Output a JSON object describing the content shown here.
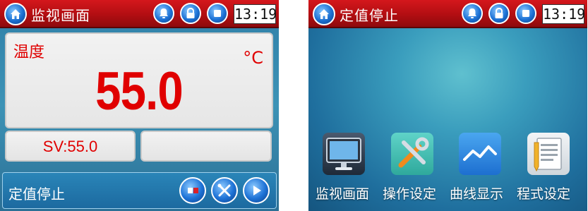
{
  "left_screen": {
    "title": "监视画面",
    "clock": "13:19",
    "pv": {
      "label": "温度",
      "value": "55.0",
      "unit": "°C"
    },
    "sv": {
      "text": "SV:55.0"
    },
    "status": "定值停止"
  },
  "right_screen": {
    "title": "定值停止",
    "clock": "13:19",
    "apps": [
      {
        "label": "监视画面",
        "icon": "monitor-icon"
      },
      {
        "label": "操作设定",
        "icon": "tools-icon"
      },
      {
        "label": "曲线显示",
        "icon": "curve-icon"
      },
      {
        "label": "程式设定",
        "icon": "document-icon"
      }
    ]
  },
  "colors": {
    "titlebar": "#c4121a",
    "pv_red": "#e00000",
    "accent_blue": "#1d72d6"
  }
}
